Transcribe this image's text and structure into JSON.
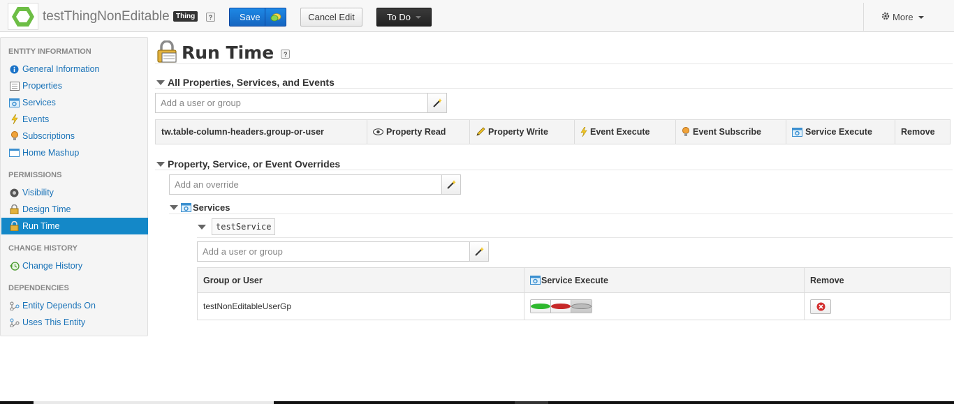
{
  "header": {
    "entity_name": "testThingNonEditable",
    "entity_type": "Thing",
    "help_label": "?",
    "save_label": "Save",
    "cancel_label": "Cancel Edit",
    "todo_label": "To Do",
    "more_label": "More",
    "colors": {
      "save": "#1565c0",
      "todo": "#222222",
      "logo": "#6dbe45"
    }
  },
  "sidebar": {
    "sections": [
      {
        "title": "ENTITY INFORMATION"
      },
      {
        "title": "PERMISSIONS"
      },
      {
        "title": "CHANGE HISTORY"
      },
      {
        "title": "DEPENDENCIES"
      }
    ],
    "items": [
      {
        "label": "General Information",
        "icon": "info-icon"
      },
      {
        "label": "Properties",
        "icon": "properties-icon"
      },
      {
        "label": "Services",
        "icon": "services-icon"
      },
      {
        "label": "Events",
        "icon": "lightning-icon"
      },
      {
        "label": "Subscriptions",
        "icon": "subscription-icon"
      },
      {
        "label": "Home Mashup",
        "icon": "mashup-icon"
      },
      {
        "label": "Visibility",
        "icon": "visibility-icon"
      },
      {
        "label": "Design Time",
        "icon": "lock-icon"
      },
      {
        "label": "Run Time",
        "icon": "lock-icon",
        "active": true
      },
      {
        "label": "Change History",
        "icon": "history-icon"
      },
      {
        "label": "Entity Depends On",
        "icon": "dependency-icon"
      },
      {
        "label": "Uses This Entity",
        "icon": "dependency-icon"
      }
    ],
    "active_color": "#1488c8"
  },
  "main": {
    "title": "Run Time",
    "all_section": {
      "title": "All Properties, Services, and Events",
      "add_placeholder": "Add a user or group",
      "columns": [
        "tw.table-column-headers.group-or-user",
        "Property Read",
        "Property Write",
        "Event Execute",
        "Event Subscribe",
        "Service Execute",
        "Remove"
      ]
    },
    "overrides": {
      "title": "Property, Service, or Event Overrides",
      "add_placeholder": "Add an override",
      "services_label": "Services",
      "service_name": "testService",
      "user_placeholder": "Add a user or group",
      "table": {
        "headers": [
          "Group or User",
          "Service Execute",
          "Remove"
        ],
        "rows": [
          {
            "user": "testNonEditableUserGp",
            "state": "neutral"
          }
        ]
      }
    }
  }
}
